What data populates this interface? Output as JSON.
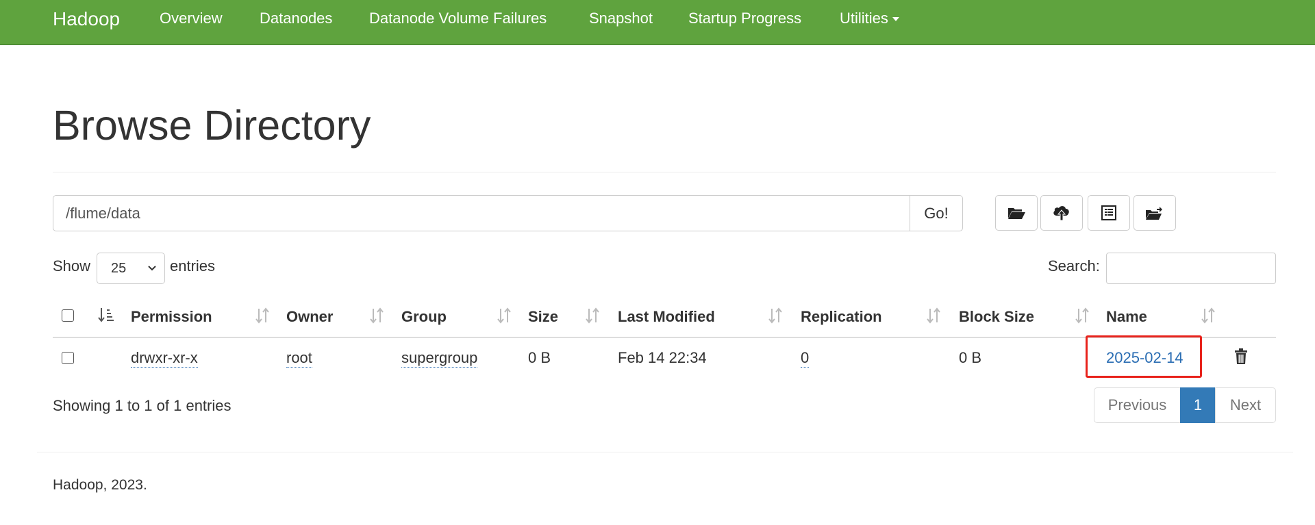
{
  "navbar": {
    "brand": "Hadoop",
    "items": [
      "Overview",
      "Datanodes",
      "Datanode Volume Failures",
      "Snapshot",
      "Startup Progress",
      "Utilities"
    ],
    "bg_color": "#5fa33e"
  },
  "page": {
    "title": "Browse Directory"
  },
  "path_bar": {
    "value": "/flume/data",
    "go_label": "Go!",
    "tools": [
      "open-folder-icon",
      "cloud-upload-icon",
      "list-icon",
      "move-folder-icon"
    ]
  },
  "controls": {
    "show_label": "Show",
    "page_size": "25",
    "entries_label": "entries",
    "search_label": "Search:",
    "search_value": ""
  },
  "table": {
    "headers": [
      "Permission",
      "Owner",
      "Group",
      "Size",
      "Last Modified",
      "Replication",
      "Block Size",
      "Name"
    ],
    "rows": [
      {
        "permission": "drwxr-xr-x",
        "owner": "root",
        "group": "supergroup",
        "size": "0 B",
        "last_modified": "Feb 14 22:34",
        "replication": "0",
        "block_size": "0 B",
        "name": "2025-02-14"
      }
    ],
    "link_color": "#2a6db3",
    "highlight_color": "#e8231c"
  },
  "footer_table": {
    "info": "Showing 1 to 1 of 1 entries",
    "previous": "Previous",
    "current_page": "1",
    "next": "Next",
    "active_color": "#337ab7"
  },
  "footer": {
    "text": "Hadoop, 2023."
  }
}
